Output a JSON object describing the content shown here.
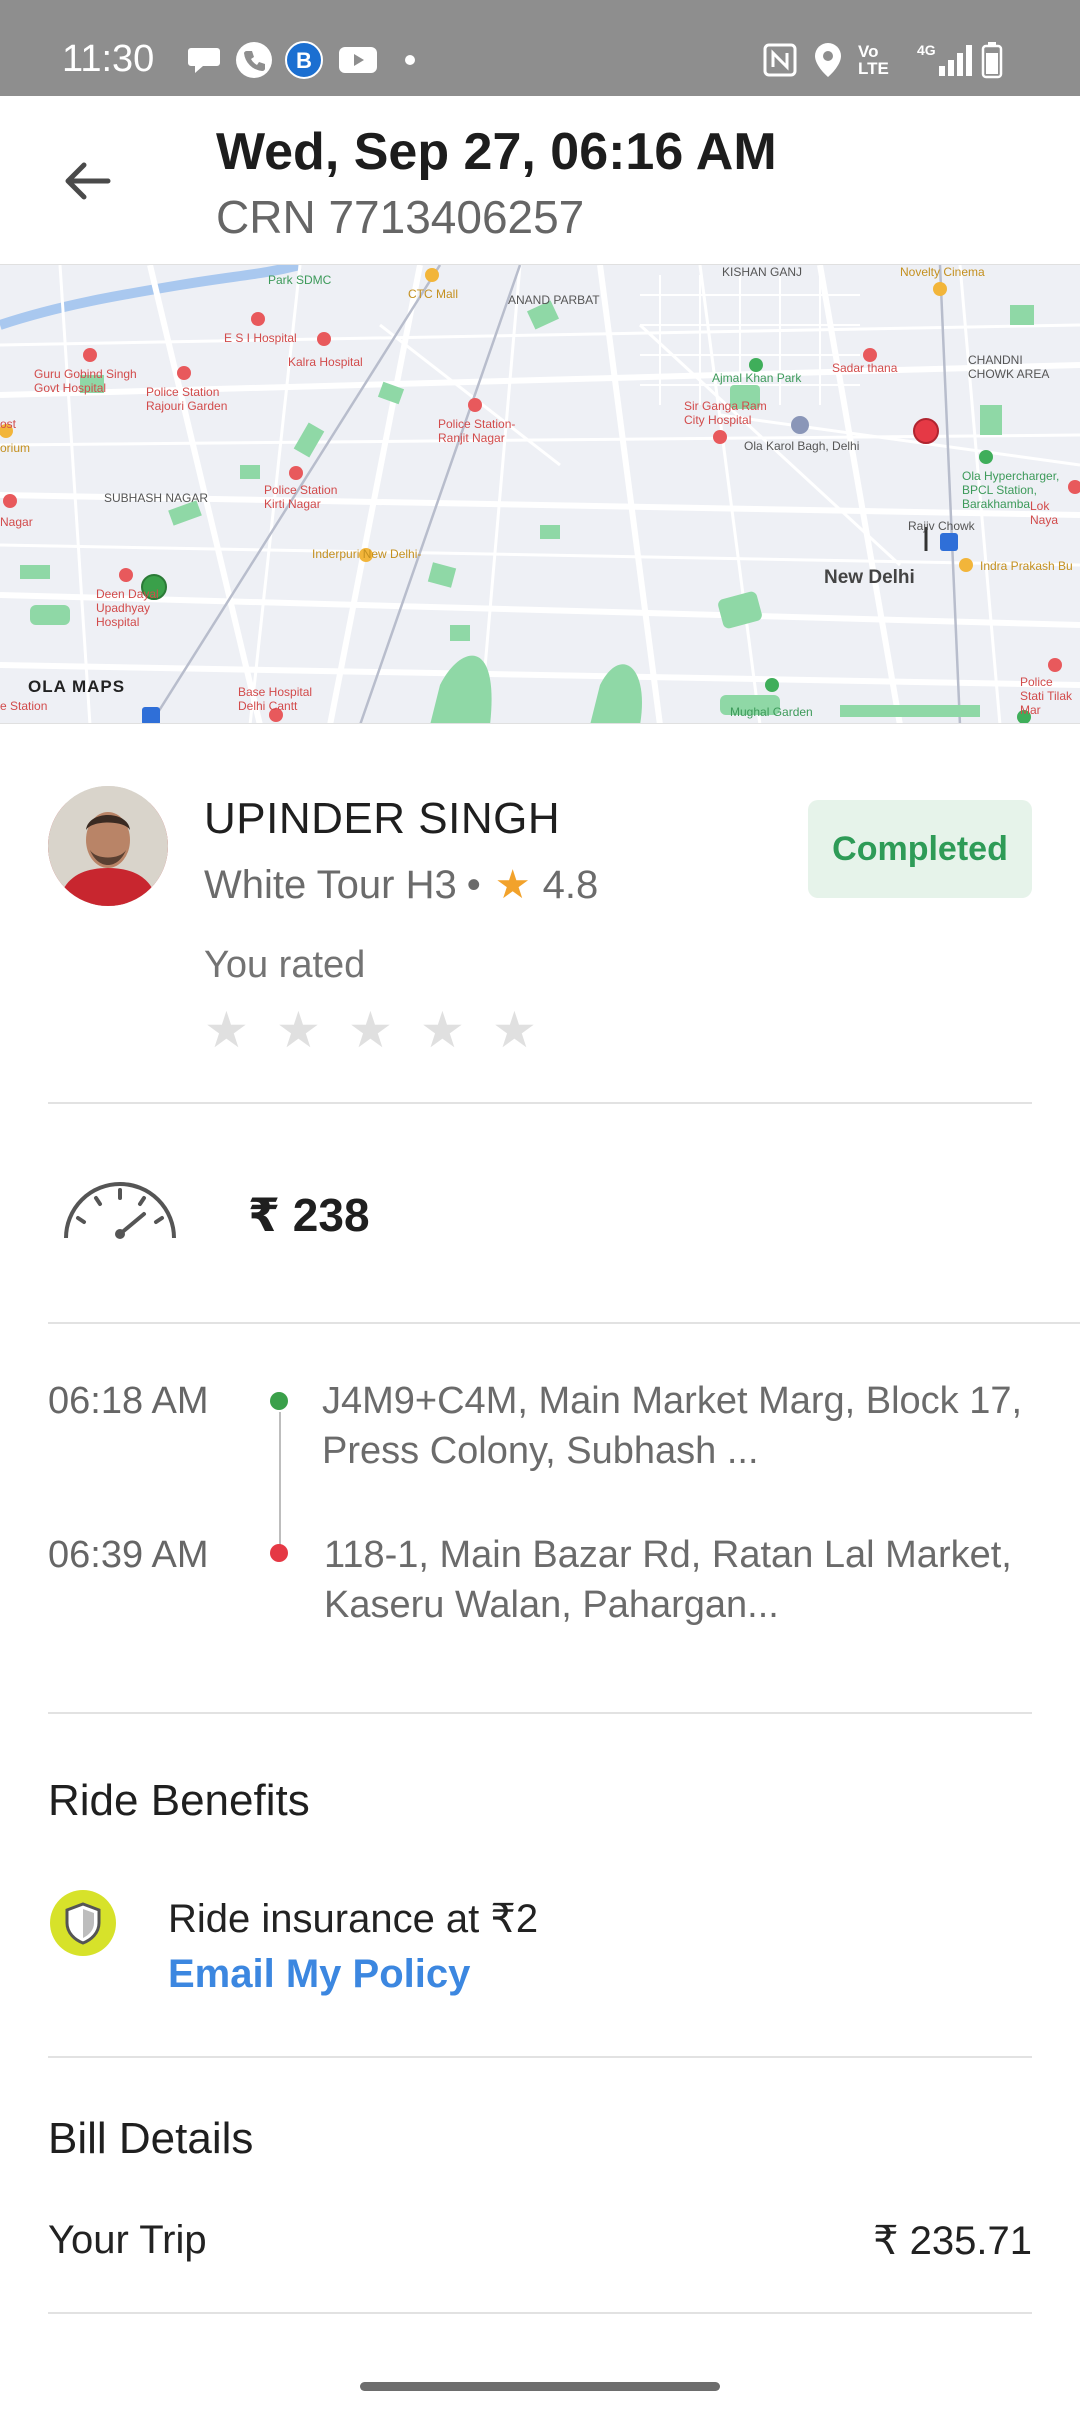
{
  "status_bar": {
    "time": "11:30",
    "icons_left": [
      "chat-bubble-icon",
      "phone-icon",
      "b-app-icon",
      "youtube-icon",
      "dot-icon"
    ],
    "icons_right": [
      "nfc-icon",
      "location-icon",
      "volte-icon",
      "signal-4g-icon",
      "battery-icon"
    ],
    "volte_text": "Vo LTE",
    "network_text": "4G"
  },
  "header": {
    "title": "Wed, Sep 27, 06:16 AM",
    "crn": "CRN 7713406257"
  },
  "map": {
    "brand": "OLA MAPS",
    "labels": {
      "park_sdmc": "Park SDMC",
      "ctc_mall": "CTC Mall",
      "anand_parbat": "ANAND PARBAT",
      "kishan_ganj": "KISHAN GANJ",
      "novelty_cinema": "Novelty Cinema",
      "esi_hospital": "E S I Hospital",
      "kalra_hospital": "Kalra Hospital",
      "guru_gobind": "Guru Gobind Singh Govt Hospital",
      "ps_rajouri": "Police Station Rajouri Garden",
      "ajmal_khan": "Ajmal Khan Park",
      "sadar_thana": "Sadar thana",
      "chandni_chowk": "CHANDNI CHOWK AREA",
      "ps_ranjit": "Police Station- Ranjit Nagar",
      "sir_ganga_ram": "Sir Ganga Ram City Hospital",
      "ola_karol_bagh": "Ola Karol Bagh, Delhi",
      "ola_hypercharger": "Ola Hypercharger, BPCL Station, Barakhamba",
      "lok_nayak": "Lok Naya",
      "subhash_nagar": "SUBHASH NAGAR",
      "ps_kirti": "Police Station Kirti Nagar",
      "inderpuri": "Inderpuri New Delhi-",
      "rajiv_chowk": "Rajiv Chowk",
      "indra_prakash": "Indra Prakash Bu",
      "new_delhi": "New Delhi",
      "deen_dayal": "Deen Dayal Upadhyay Hospital",
      "base_hospital": "Base Hospital Delhi Cantt",
      "mughal_garden": "Mughal Garden",
      "ps_tilak": "Police Stati Tilak Mar",
      "e_station": "e Station",
      "nagar_left": "Nagar",
      "ost": "ost",
      "orium": "orium"
    }
  },
  "driver": {
    "name": "UPINDER SINGH",
    "car": "White Tour H3",
    "separator": "•",
    "rating": "4.8",
    "status": "Completed",
    "you_rated_label": "You rated",
    "user_rating_stars": 0,
    "max_stars": 5
  },
  "fare": {
    "amount": "₹ 238"
  },
  "trip": {
    "pickup_time": "06:18 AM",
    "pickup_address": "J4M9+C4M, Main Market Marg, Block 17, Press Colony, Subhash ...",
    "drop_time": "06:39 AM",
    "drop_address": "118-1, Main Bazar Rd, Ratan Lal Market, Kaseru Walan, Pahargan..."
  },
  "benefits": {
    "title": "Ride Benefits",
    "insurance_text": "Ride insurance at ₹2",
    "email_policy_label": "Email My Policy"
  },
  "bill": {
    "title": "Bill Details",
    "trip_label": "Your Trip",
    "trip_value": "₹ 235.71"
  },
  "colors": {
    "completed_green": "#2e9b57",
    "link_blue": "#3c87e0",
    "rating_star": "#f2a22b",
    "pickup_dot": "#3aa04a",
    "drop_dot": "#e53945"
  }
}
